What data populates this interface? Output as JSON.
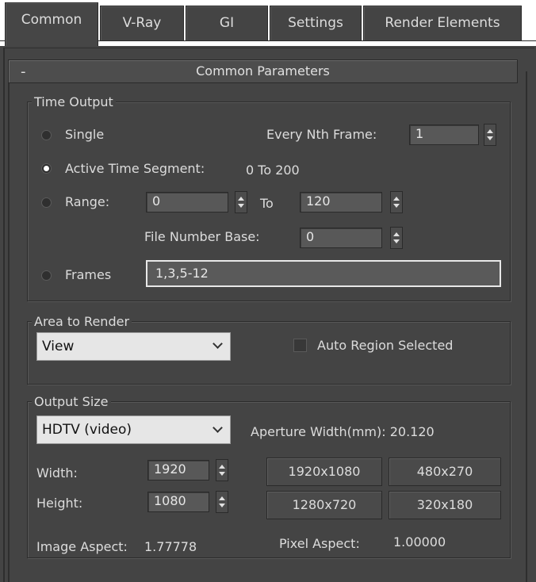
{
  "tabs": [
    {
      "label": "Common",
      "active": true
    },
    {
      "label": "V-Ray"
    },
    {
      "label": "GI"
    },
    {
      "label": "Settings"
    },
    {
      "label": "Render Elements"
    }
  ],
  "rollout": {
    "collapse_symbol": "-",
    "title": "Common Parameters"
  },
  "time_output": {
    "title": "Time Output",
    "single_label": "Single",
    "every_nth_label": "Every Nth Frame:",
    "every_nth_value": "1",
    "active_segment_label": "Active Time Segment:",
    "active_segment_value": "0 To 200",
    "range_label": "Range:",
    "range_from": "0",
    "range_to_label": "To",
    "range_to": "120",
    "file_number_base_label": "File Number Base:",
    "file_number_base_value": "0",
    "frames_label": "Frames",
    "frames_value": "1,3,5-12",
    "selected": "active_time_segment"
  },
  "area_to_render": {
    "title": "Area to Render",
    "dropdown_value": "View",
    "auto_region_label": "Auto Region Selected",
    "auto_region_checked": false
  },
  "output_size": {
    "title": "Output Size",
    "preset_value": "HDTV (video)",
    "aperture_label": "Aperture Width(mm): 20.120",
    "width_label": "Width:",
    "width_value": "1920",
    "height_label": "Height:",
    "height_value": "1080",
    "presets": [
      "1920x1080",
      "480x270",
      "1280x720",
      "320x180"
    ],
    "image_aspect_label": "Image Aspect:",
    "image_aspect_value": "1.77778",
    "pixel_aspect_label": "Pixel Aspect:",
    "pixel_aspect_value": "1.00000"
  },
  "colors": {
    "panel_bg": "#444444",
    "tab_strip_bg": "#ffffff",
    "text": "#dcdcdc"
  }
}
